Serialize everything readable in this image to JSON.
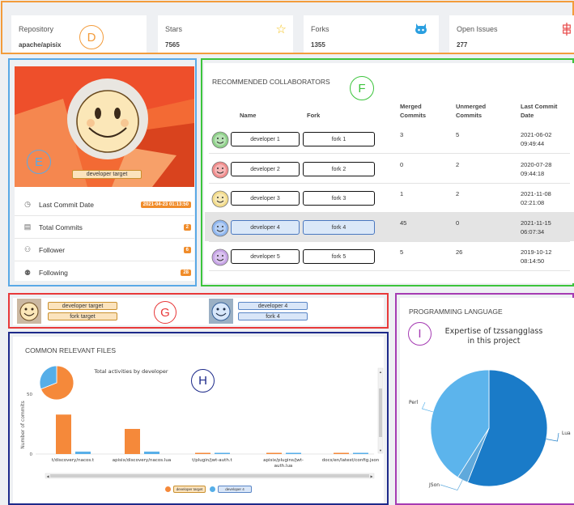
{
  "markers": {
    "d": "D",
    "e": "E",
    "f": "F",
    "g": "G",
    "h": "H",
    "i": "I"
  },
  "stats": [
    {
      "label": "Repository",
      "value": "apache/apisix",
      "icon": "star"
    },
    {
      "label": "Stars",
      "value": "7565",
      "icon": "star-icon"
    },
    {
      "label": "Forks",
      "value": "1355",
      "icon": "github-icon"
    },
    {
      "label": "Open Issues",
      "value": "277",
      "icon": "issue-icon"
    }
  ],
  "profile": {
    "name": "developer target",
    "rows": [
      {
        "label": "Last Commit Date",
        "value": "2021-04-23 01:13:50",
        "icon": "clock-icon"
      },
      {
        "label": "Total Commits",
        "value": "2",
        "icon": "calendar-icon"
      },
      {
        "label": "Follower",
        "value": "6",
        "icon": "follower-icon"
      },
      {
        "label": "Following",
        "value": "28",
        "icon": "following-icon"
      }
    ]
  },
  "collaborators": {
    "title": "RECOMMENDED COLLABORATORS",
    "headers": {
      "name": "Name",
      "fork": "Fork",
      "merged1": "Merged",
      "merged2": "Commits",
      "unmerged1": "Unmerged",
      "unmerged2": "Commits",
      "last1": "Last Commit",
      "last2": "Date"
    },
    "rows": [
      {
        "name": "developer 1",
        "fork": "fork 1",
        "merged": "3",
        "unmerged": "5",
        "date": "2021-06-02",
        "time": "09:49:44",
        "face": "#8fd18a"
      },
      {
        "name": "developer 2",
        "fork": "fork 2",
        "merged": "0",
        "unmerged": "2",
        "date": "2020-07-28",
        "time": "09:44:18",
        "face": "#f08c8c"
      },
      {
        "name": "developer 3",
        "fork": "fork 3",
        "merged": "1",
        "unmerged": "2",
        "date": "2021-11-08",
        "time": "02:21:08",
        "face": "#f3dc8c"
      },
      {
        "name": "developer 4",
        "fork": "fork 4",
        "merged": "45",
        "unmerged": "0",
        "date": "2021-11-15",
        "time": "06:07:34",
        "face": "#8fb6ee"
      },
      {
        "name": "developer 5",
        "fork": "fork 5",
        "merged": "5",
        "unmerged": "26",
        "date": "2019-10-12",
        "time": "08:14:50",
        "face": "#c7a4e6"
      }
    ]
  },
  "compare": {
    "left": {
      "name": "developer target",
      "fork": "fork target"
    },
    "right": {
      "name": "developer 4",
      "fork": "fork 4"
    }
  },
  "files": {
    "title": "COMMON RELEVANT FILES",
    "subtitle": "Total activities by developer",
    "legend": [
      "developer target",
      "developer 4"
    ],
    "colors": {
      "target": "#f5893a",
      "dev4": "#56aee8"
    }
  },
  "language": {
    "title": "PROGRAMMING LANGUAGE",
    "chart_title_1": "Expertise of tzssangglass",
    "chart_title_2": "in this project"
  },
  "chart_data": [
    {
      "type": "bar",
      "categories": [
        "t/discovery/nacos.t",
        "apisix/discovery/nacos.lua",
        "t/plugin/jwt-auth.t",
        "apisix/plugins/jwt-auth.lua",
        "docs/en/latest/config.json"
      ],
      "category_lines": [
        [
          "t/discovery/nacos.t"
        ],
        [
          "apisix/discovery/nacos.lua"
        ],
        [
          "t/plugin/jwt-auth.t"
        ],
        [
          "apisix/plugins/jwt-",
          "auth.lua"
        ],
        [
          "docs/en/latest/config.json"
        ]
      ],
      "series": [
        {
          "name": "developer target",
          "values": [
            33,
            21,
            1,
            1,
            1
          ]
        },
        {
          "name": "developer 4",
          "values": [
            2,
            2,
            1,
            1,
            1
          ]
        }
      ],
      "ylabel": "Number of commits",
      "yticks": [
        0,
        50
      ],
      "ylim": [
        0,
        65
      ]
    },
    {
      "type": "pie",
      "labels": [
        "Lua",
        "JSon",
        "Perl"
      ],
      "values": [
        56,
        3,
        41
      ],
      "colors": [
        "#1a7bc8",
        "#5fa9dc",
        "#5cb4ec"
      ]
    },
    {
      "type": "pie",
      "labels": [],
      "values": [
        69,
        31
      ],
      "colors": [
        "#f5893a",
        "#56aee8"
      ]
    }
  ]
}
